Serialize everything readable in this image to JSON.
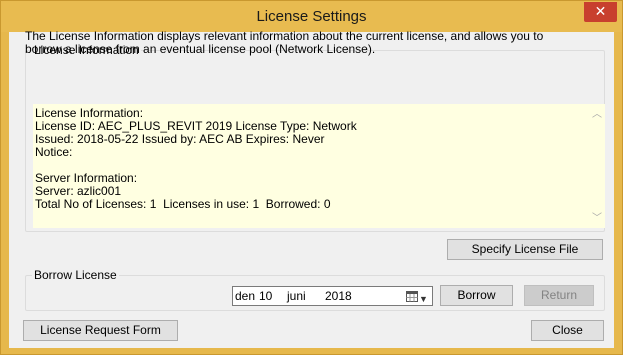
{
  "window": {
    "title": "License Settings",
    "close_glyph": "✕"
  },
  "license_info": {
    "group_label": "License Information",
    "description": "The License Information displays relevant information about the current license, and allows you to borrow a license from an eventual license pool (Network License).",
    "details_text": "License Information:\nLicense ID: AEC_PLUS_REVIT 2019 License Type: Network\nIssued: 2018-05-22 Issued by: AEC AB Expires: Never\nNotice:\n\nServer Information:\nServer: azlic001\nTotal No of Licenses: 1  Licenses in use: 1  Borrowed: 0"
  },
  "buttons": {
    "specify_license_file": "Specify License File",
    "borrow": "Borrow",
    "return": "Return",
    "license_request_form": "License Request Form",
    "close": "Close"
  },
  "borrow": {
    "group_label": "Borrow License",
    "date": {
      "day_prefix": "den",
      "day": "10",
      "month": "juni",
      "year": "2018"
    }
  },
  "colors": {
    "title_bar": "#e8bb50",
    "close_button": "#c8402e",
    "info_background": "#ffffe1"
  }
}
